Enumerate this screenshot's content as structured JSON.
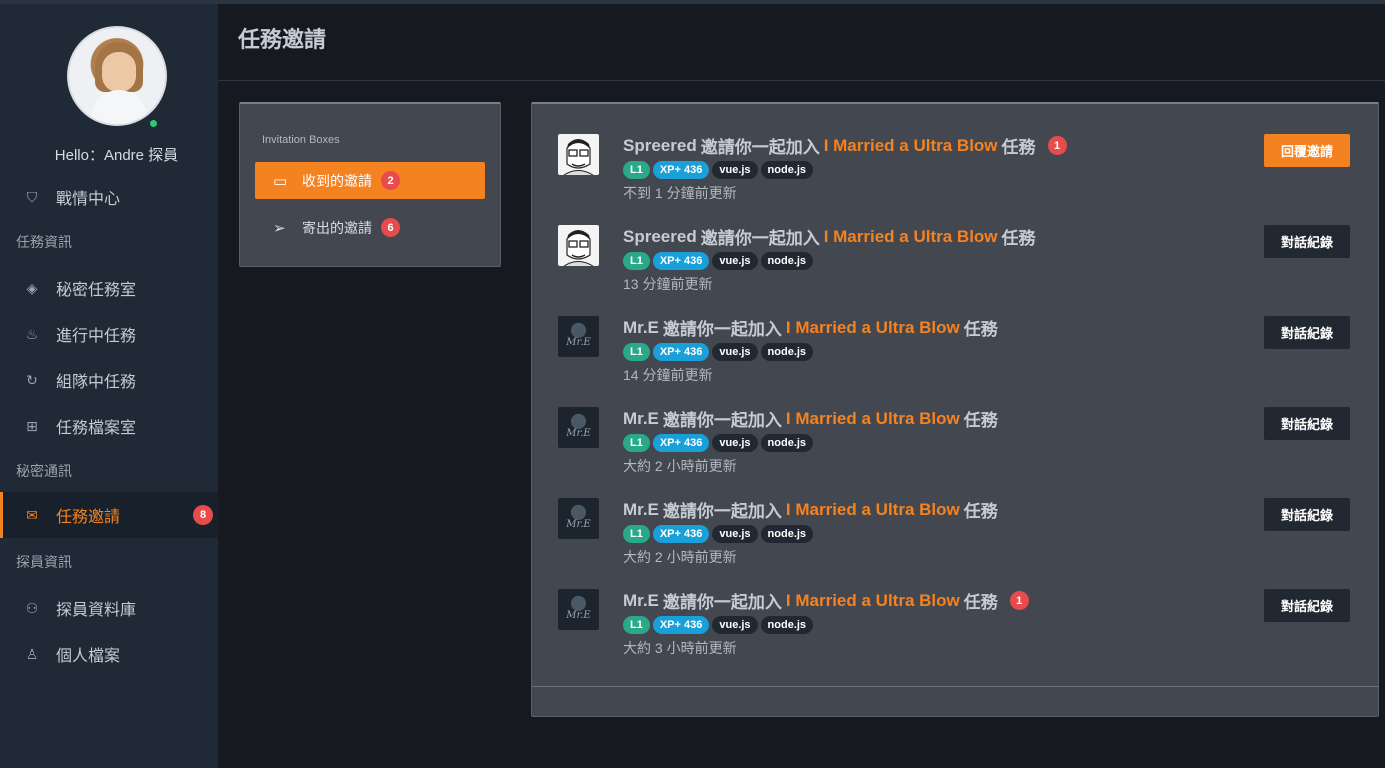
{
  "sidebar": {
    "hello": "Hello：Andre 探員",
    "items": [
      {
        "label": "戰情中心",
        "icon": "shield-icon",
        "glyph": "⛉"
      },
      {
        "label": "秘密任務室",
        "icon": "layers-icon",
        "glyph": "◈"
      },
      {
        "label": "進行中任務",
        "icon": "fire-icon",
        "glyph": "♨"
      },
      {
        "label": "組隊中任務",
        "icon": "refresh-icon",
        "glyph": "↻"
      },
      {
        "label": "任務檔案室",
        "icon": "grid-icon",
        "glyph": "⊞"
      },
      {
        "label": "任務邀請",
        "icon": "envelope-icon",
        "glyph": "✉",
        "count": "8"
      },
      {
        "label": "探員資料庫",
        "icon": "users-icon",
        "glyph": "⚇"
      },
      {
        "label": "個人檔案",
        "icon": "user-icon",
        "glyph": "♙"
      }
    ],
    "sections": [
      "任務資訊",
      "秘密通訊",
      "探員資訊"
    ]
  },
  "header": {
    "title": "任務邀請"
  },
  "boxes": {
    "title": "Invitation Boxes",
    "received": {
      "label": "收到的邀請",
      "count": "2",
      "icon": "inbox-icon",
      "glyph": "▭"
    },
    "sent": {
      "label": "寄出的邀請",
      "count": "6",
      "icon": "paper-plane-icon",
      "glyph": "➢"
    }
  },
  "invitations": [
    {
      "user": "Spreered",
      "middle": "邀請你一起加入",
      "project": "I Married a Ultra Blow",
      "suffix": "任務",
      "unread": "1",
      "level": "L1",
      "xp": "XP+ 436",
      "skills": [
        "vue.js",
        "node.js"
      ],
      "time": "不到 1 分鐘前更新",
      "action": "回覆邀請"
    },
    {
      "user": "Spreered",
      "middle": "邀請你一起加入",
      "project": "I Married a Ultra Blow",
      "suffix": "任務",
      "unread": "",
      "level": "L1",
      "xp": "XP+ 436",
      "skills": [
        "vue.js",
        "node.js"
      ],
      "time": "13 分鐘前更新",
      "action": "對話紀錄"
    },
    {
      "user": "Mr.E",
      "middle": "邀請你一起加入",
      "project": "I Married a Ultra Blow",
      "suffix": "任務",
      "unread": "",
      "level": "L1",
      "xp": "XP+ 436",
      "skills": [
        "vue.js",
        "node.js"
      ],
      "time": "14 分鐘前更新",
      "action": "對話紀錄"
    },
    {
      "user": "Mr.E",
      "middle": "邀請你一起加入",
      "project": "I Married a Ultra Blow",
      "suffix": "任務",
      "unread": "",
      "level": "L1",
      "xp": "XP+ 436",
      "skills": [
        "vue.js",
        "node.js"
      ],
      "time": "大約 2 小時前更新",
      "action": "對話紀錄"
    },
    {
      "user": "Mr.E",
      "middle": "邀請你一起加入",
      "project": "I Married a Ultra Blow",
      "suffix": "任務",
      "unread": "",
      "level": "L1",
      "xp": "XP+ 436",
      "skills": [
        "vue.js",
        "node.js"
      ],
      "time": "大約 2 小時前更新",
      "action": "對話紀錄"
    },
    {
      "user": "Mr.E",
      "middle": "邀請你一起加入",
      "project": "I Married a Ultra Blow",
      "suffix": "任務",
      "unread": "1",
      "level": "L1",
      "xp": "XP+ 436",
      "skills": [
        "vue.js",
        "node.js"
      ],
      "time": "大約 3 小時前更新",
      "action": "對話紀錄"
    }
  ],
  "colors": {
    "accent": "#f58220",
    "badge": "#e84b4b",
    "level": "#2aa88a",
    "xp": "#1aa0d8"
  }
}
